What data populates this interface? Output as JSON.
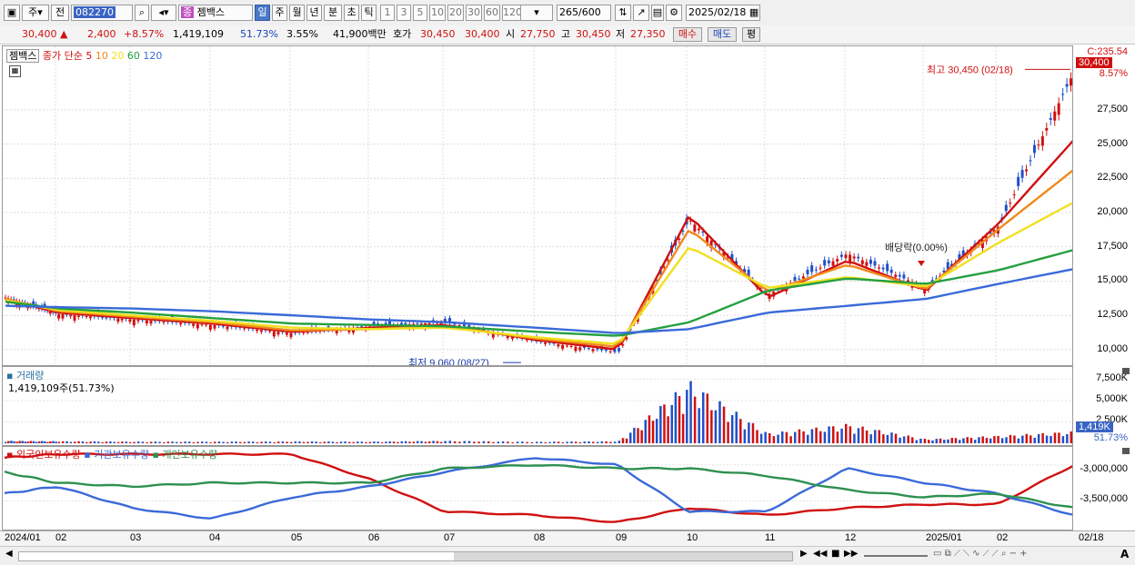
{
  "toolbar": {
    "period_btn": "주",
    "prev_btn": "전",
    "code": "082270",
    "name": "젬백스",
    "name_tag": "종",
    "tf_day": "일",
    "tf_week": "주",
    "tf_month": "월",
    "tf_year": "년",
    "tf_min": "분",
    "tf_sec": "초",
    "tf_tick": "틱",
    "intervals": [
      "1",
      "3",
      "5",
      "10",
      "20",
      "30",
      "60",
      "120"
    ],
    "count_value": "265",
    "count_total": "/600",
    "date": "2025/02/18"
  },
  "infobar": {
    "price": "30,400",
    "change": "2,400",
    "change_pct": "+8.57%",
    "volume": "1,419,109",
    "vol_ratio": "51.73%",
    "turnover_pct": "3.55%",
    "amount": "41,900백만",
    "bid_label": "호가",
    "ask_price": "30,450",
    "bid_price": "30,400",
    "open_label": "시",
    "open": "27,750",
    "high_label": "고",
    "high": "30,450",
    "low_label": "저",
    "low": "27,350",
    "buy_btn": "매수",
    "sell_btn": "매도",
    "eval_btn": "평"
  },
  "price_panel": {
    "name": "젬백스",
    "ma_label": "종가 단순",
    "ma_periods": [
      "5",
      "10",
      "20",
      "60",
      "120"
    ],
    "ma_colors": [
      "#d01010",
      "#f08a1c",
      "#f0e020",
      "#24a040",
      "#3a6ad8"
    ],
    "top_label": "C:235.54",
    "last_price_badge": "30,400",
    "last_pct": "8.57%",
    "high_annot": "최고 30,450 (02/18)",
    "low_annot": "최저 9,060 (08/27)",
    "dividend_annot": "배당락(0.00%)"
  },
  "volume_panel": {
    "title": "거래량",
    "value": "1,419,109주(51.73%)",
    "y_ticks": [
      "7,500K",
      "5,000K",
      "2,500K"
    ],
    "badge": "1,419K",
    "badge_pct": "51.73%"
  },
  "holding_panel": {
    "titles": [
      "외국인보유수량",
      "기관보유수량",
      "개인보유수량"
    ],
    "colors": [
      "#d01010",
      "#3a6ad8",
      "#2e9050"
    ],
    "y_ticks": [
      "-3,000,000",
      "-3,500,000"
    ]
  },
  "x_labels": [
    "2024/01",
    "02",
    "03",
    "04",
    "05",
    "06",
    "07",
    "08",
    "09",
    "10",
    "11",
    "12",
    "2025/01",
    "02",
    "02/18"
  ],
  "chart_data": [
    {
      "type": "line",
      "title": "젬백스",
      "x": [
        "2024/01",
        "02",
        "03",
        "04",
        "05",
        "06",
        "07",
        "08",
        "09",
        "10",
        "11",
        "12",
        "2025/01",
        "02",
        "02/18"
      ],
      "series": [
        {
          "name": "종가",
          "values": [
            13800,
            12600,
            12200,
            11800,
            11200,
            11700,
            12000,
            10600,
            9800,
            19500,
            14000,
            17000,
            14500,
            19000,
            30400
          ]
        },
        {
          "name": "5",
          "values": [
            13700,
            12700,
            12300,
            11900,
            11300,
            11600,
            11800,
            10700,
            10000,
            19800,
            13800,
            16500,
            14300,
            19200,
            25400
          ]
        },
        {
          "name": "10",
          "values": [
            13700,
            12800,
            12400,
            12000,
            11400,
            11500,
            11700,
            10800,
            10200,
            18800,
            14200,
            16200,
            14400,
            18800,
            23200
          ]
        },
        {
          "name": "20",
          "values": [
            13600,
            12900,
            12500,
            12100,
            11600,
            11500,
            11600,
            10900,
            10400,
            17500,
            14500,
            15300,
            14600,
            17800,
            20800
          ]
        },
        {
          "name": "60",
          "values": [
            13500,
            13000,
            12700,
            12300,
            11900,
            11800,
            11700,
            11300,
            11000,
            12000,
            14300,
            15200,
            14800,
            15800,
            17300
          ]
        },
        {
          "name": "120",
          "values": [
            13200,
            13100,
            13000,
            12800,
            12500,
            12200,
            12000,
            11600,
            11200,
            11500,
            12700,
            13200,
            13700,
            14800,
            15900
          ]
        }
      ],
      "ylim": [
        9000,
        32000
      ],
      "y_ticks": [
        10000,
        12500,
        15000,
        17500,
        20000,
        22500,
        25000,
        27500
      ],
      "annotations": [
        "최고 30,450 (02/18)",
        "최저 9,060 (08/27)",
        "배당락(0.00%)"
      ]
    },
    {
      "type": "bar",
      "title": "거래량",
      "categories": [
        "2024/01",
        "02",
        "03",
        "04",
        "05",
        "06",
        "07",
        "08",
        "09",
        "10",
        "11",
        "12",
        "2025/01",
        "02",
        "02/18"
      ],
      "values": [
        300,
        250,
        200,
        200,
        220,
        200,
        300,
        180,
        250,
        7400,
        1200,
        2300,
        500,
        900,
        1419
      ],
      "unit": "K",
      "ylim": [
        0,
        8500
      ]
    },
    {
      "type": "line",
      "title": "외국인보유수량 · 기관보유수량 · 개인보유수량",
      "x": [
        "2024/01",
        "02",
        "03",
        "04",
        "05",
        "06",
        "07",
        "08",
        "09",
        "10",
        "11",
        "12",
        "2025/01",
        "02",
        "02/18"
      ],
      "series": [
        {
          "name": "외국인보유수량",
          "values": [
            -2900000,
            -2850000,
            -2850000,
            -2850000,
            -2850000,
            -3200000,
            -3650000,
            -3700000,
            -3800000,
            -3600000,
            -3700000,
            -3600000,
            -3550000,
            -3550000,
            -3000000
          ]
        },
        {
          "name": "기관보유수량",
          "values": [
            -3400000,
            -3300000,
            -3600000,
            -3750000,
            -3450000,
            -3300000,
            -3100000,
            -2900000,
            -3000000,
            -3650000,
            -3650000,
            -3050000,
            -3250000,
            -3400000,
            -3700000
          ]
        },
        {
          "name": "개인보유수량",
          "values": [
            -3100000,
            -3250000,
            -3300000,
            -3250000,
            -3250000,
            -3250000,
            -3050000,
            -3000000,
            -3050000,
            -3050000,
            -3150000,
            -3350000,
            -3450000,
            -3400000,
            -3600000
          ]
        }
      ],
      "ylim": [
        -3850000,
        -2800000
      ],
      "y_ticks": [
        -3000000,
        -3500000
      ]
    }
  ]
}
